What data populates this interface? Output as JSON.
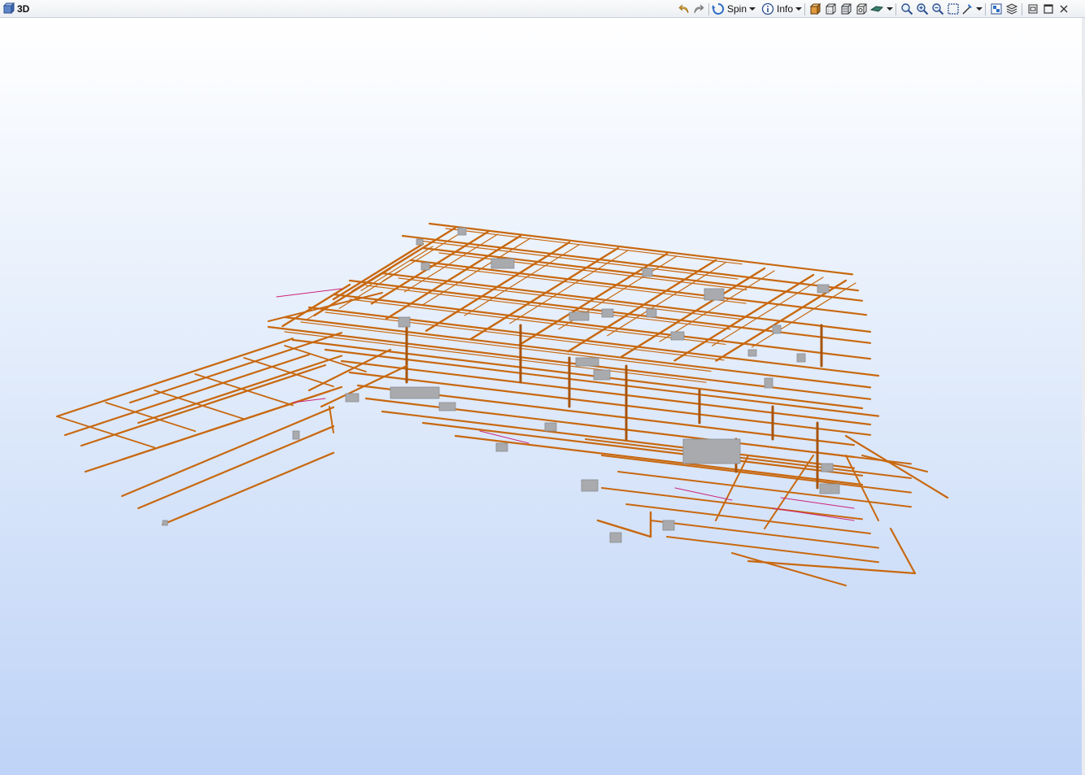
{
  "window": {
    "title": "3D",
    "icon": "3d-view-icon"
  },
  "toolbar": {
    "spin_label": "Spin",
    "info_label": "Info",
    "icons": [
      "undo-icon",
      "redo-icon",
      "spin-icon",
      "info-icon",
      "cube-view-icon",
      "wireframe-icon",
      "hidden-line-icon",
      "section-box-icon",
      "render-style-icon",
      "zoom-fit-icon",
      "zoom-in-icon",
      "zoom-out-icon",
      "zoom-window-icon",
      "pick-icon",
      "properties-icon",
      "layers-icon",
      "restore-icon",
      "maximize-icon",
      "close-icon"
    ]
  },
  "colors": {
    "pipe": "#c8680f",
    "pipe_dark": "#a8530a",
    "equipment": "#a9aaad",
    "equipment_dark": "#8a8b8f",
    "accent_line": "#cc2277",
    "background_top": "#ffffff",
    "background_bottom": "#bed3f7"
  }
}
